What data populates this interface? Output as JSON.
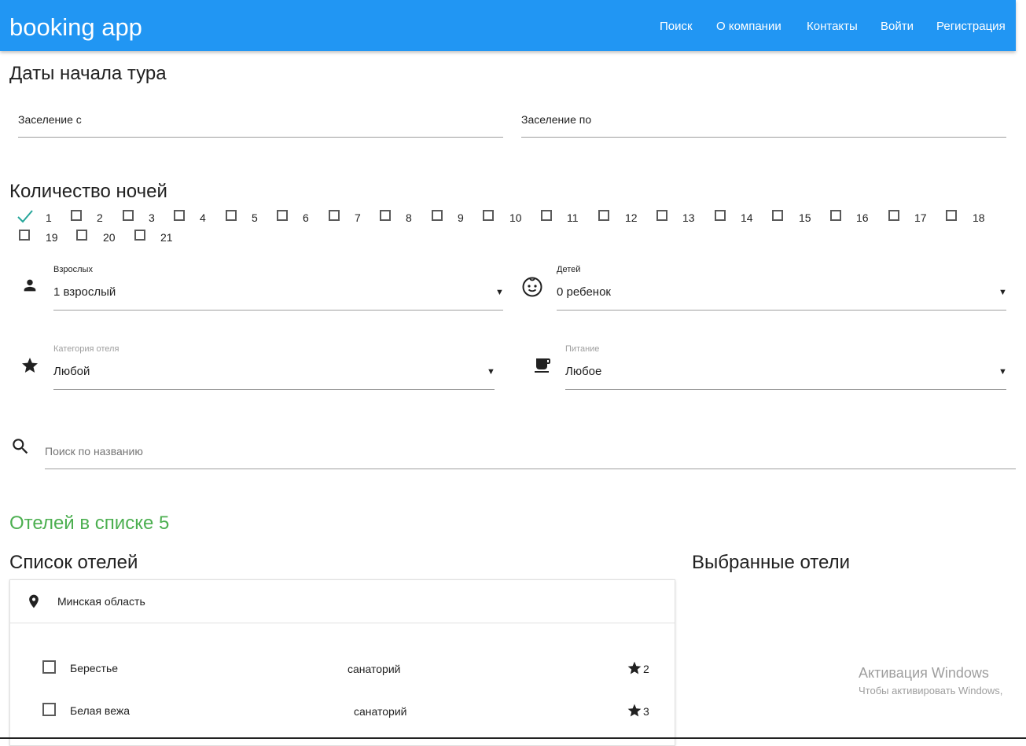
{
  "header": {
    "brand": "booking app",
    "nav": [
      "Поиск",
      "О компании",
      "Контакты",
      "Войти",
      "Регистрация"
    ]
  },
  "dates": {
    "title": "Даты начала тура",
    "from_label": "Заселение с",
    "to_label": "Заселение по"
  },
  "nights": {
    "title": "Количество ночей",
    "options": [
      "1",
      "2",
      "3",
      "4",
      "5",
      "6",
      "7",
      "8",
      "9",
      "10",
      "11",
      "12",
      "13",
      "14",
      "15",
      "16",
      "17",
      "18",
      "19",
      "20",
      "21"
    ],
    "checked": [
      "1"
    ]
  },
  "filters": {
    "adults": {
      "label": "Взрослых",
      "value": "1 взрослый"
    },
    "children": {
      "label": "Детей",
      "value": "0 ребенок"
    },
    "category": {
      "label": "Категория отеля",
      "value": "Любой"
    },
    "meal": {
      "label": "Питание",
      "value": "Любое"
    }
  },
  "search": {
    "placeholder": "Поиск по названию"
  },
  "results": {
    "count_text": "Отелей в списке 5"
  },
  "hotels": {
    "title": "Список отелей",
    "region": "Минская область",
    "items": [
      {
        "name": "Берестье",
        "type": "санаторий",
        "stars": "2"
      },
      {
        "name": "Белая вежа",
        "type": "санаторий",
        "stars": "3"
      }
    ]
  },
  "selected": {
    "title": "Выбранные отели"
  },
  "watermark": {
    "line1": "Активация Windows",
    "line2": "Чтобы активировать Windows,"
  },
  "colors": {
    "primary": "#2196f3",
    "accent_check": "#26a69a",
    "success": "#4caf50"
  }
}
